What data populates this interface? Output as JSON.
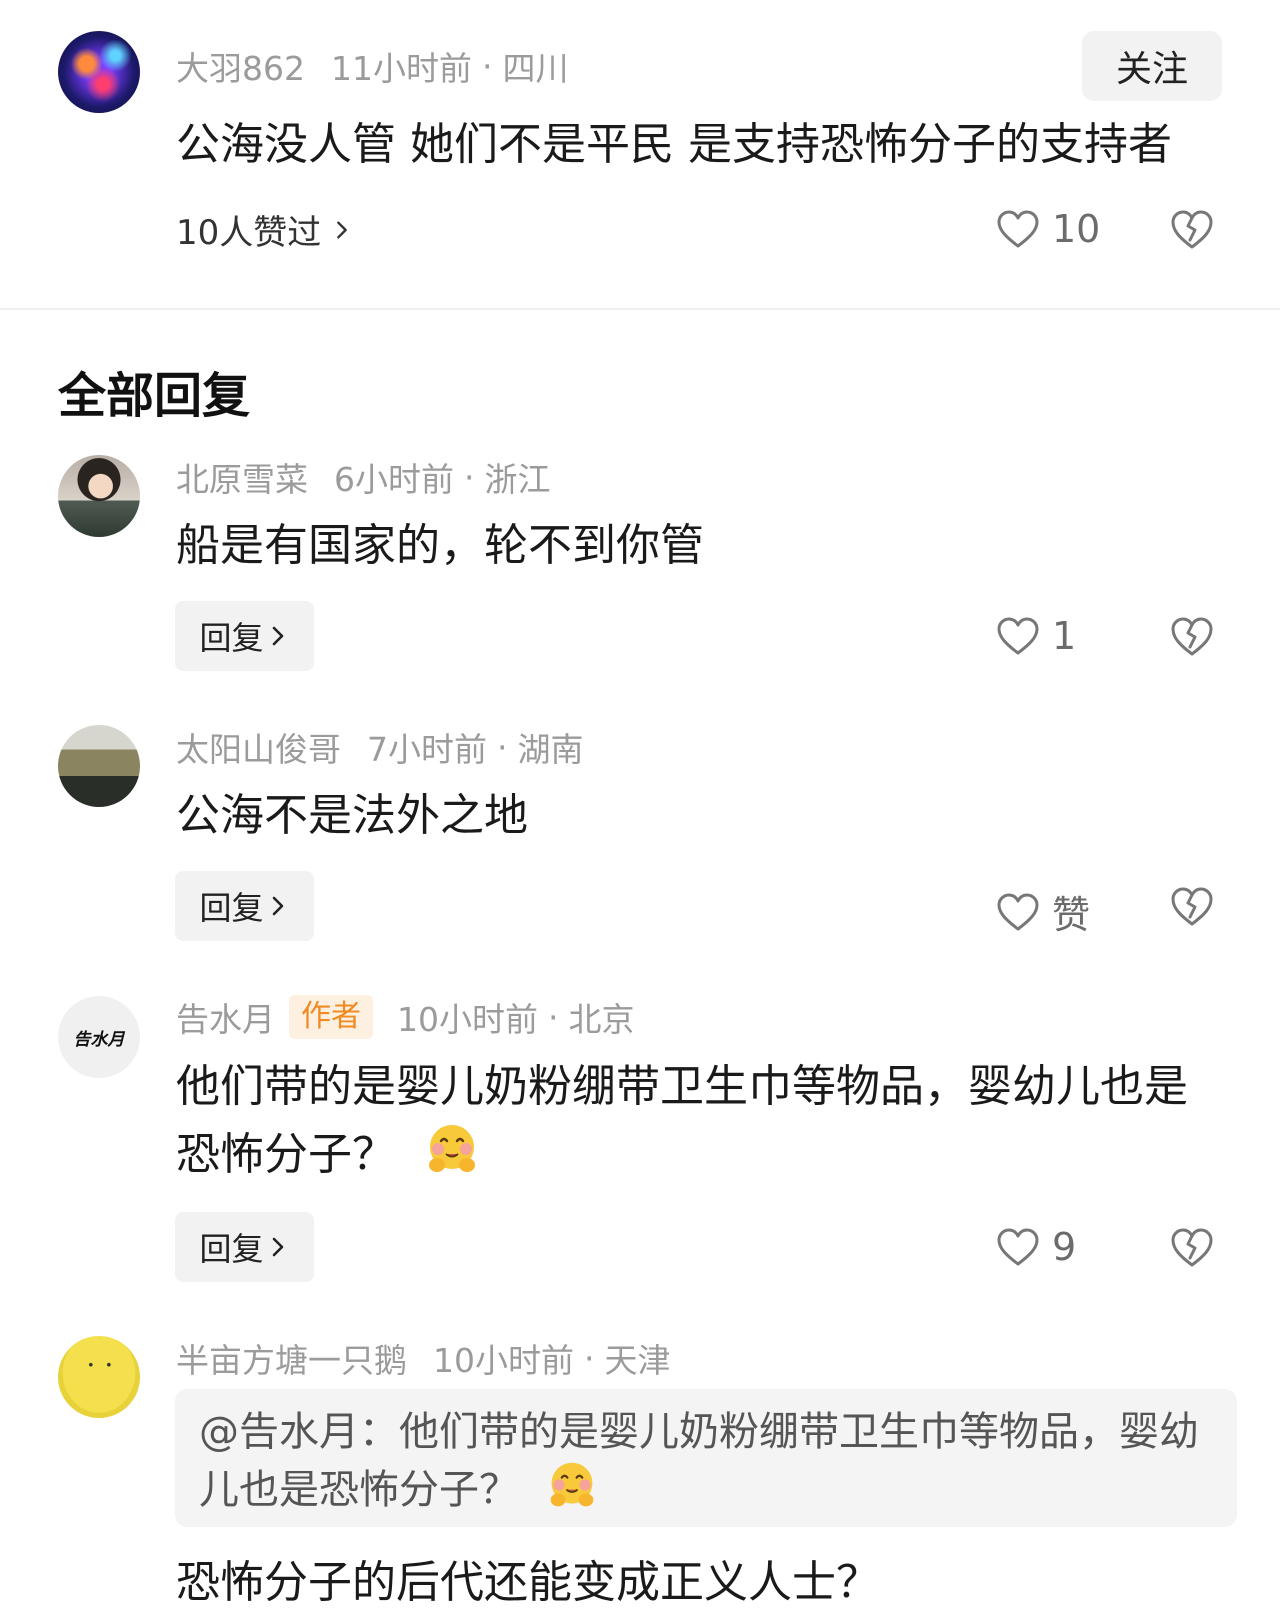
{
  "main_comment": {
    "username": "大羽862",
    "time": "11小时前",
    "location": "四川",
    "follow_label": "关注",
    "text": "公海没人管 她们不是平民 是支持恐怖分子的支持者",
    "liked_by": "10人赞过",
    "like_count": "10"
  },
  "section_title": "全部回复",
  "replies": [
    {
      "username": "北原雪菜",
      "time": "6小时前",
      "location": "浙江",
      "text": "船是有国家的，轮不到你管",
      "reply_label": "回复",
      "like_count": "1"
    },
    {
      "username": "太阳山俊哥",
      "time": "7小时前",
      "location": "湖南",
      "text": "公海不是法外之地",
      "reply_label": "回复",
      "like_count": "赞"
    },
    {
      "username": "告水月",
      "badge": "作者",
      "avatar_text": "告水月",
      "time": "10小时前",
      "location": "北京",
      "text": "他们带的是婴儿奶粉绷带卫生巾等物品，婴幼儿也是恐怖分子？",
      "reply_label": "回复",
      "like_count": "9"
    },
    {
      "username": "半亩方塘一只鹅",
      "time": "10小时前",
      "location": "天津",
      "quote": "@告水月：他们带的是婴儿奶粉绷带卫生巾等物品，婴幼儿也是恐怖分子？",
      "text_partial": "恐怖分子的后代还能变成正义人士？"
    }
  ],
  "icons": {
    "like": "heart-outline-icon",
    "dislike": "broken-heart-icon",
    "chevron": "chevron-right-icon",
    "emoji": "hugging-face-emoji"
  },
  "colors": {
    "meta_gray": "#9b9b9b",
    "author_badge_bg": "#fdf0e0",
    "author_badge_text": "#f08a22",
    "button_bg": "#f2f2f2"
  }
}
